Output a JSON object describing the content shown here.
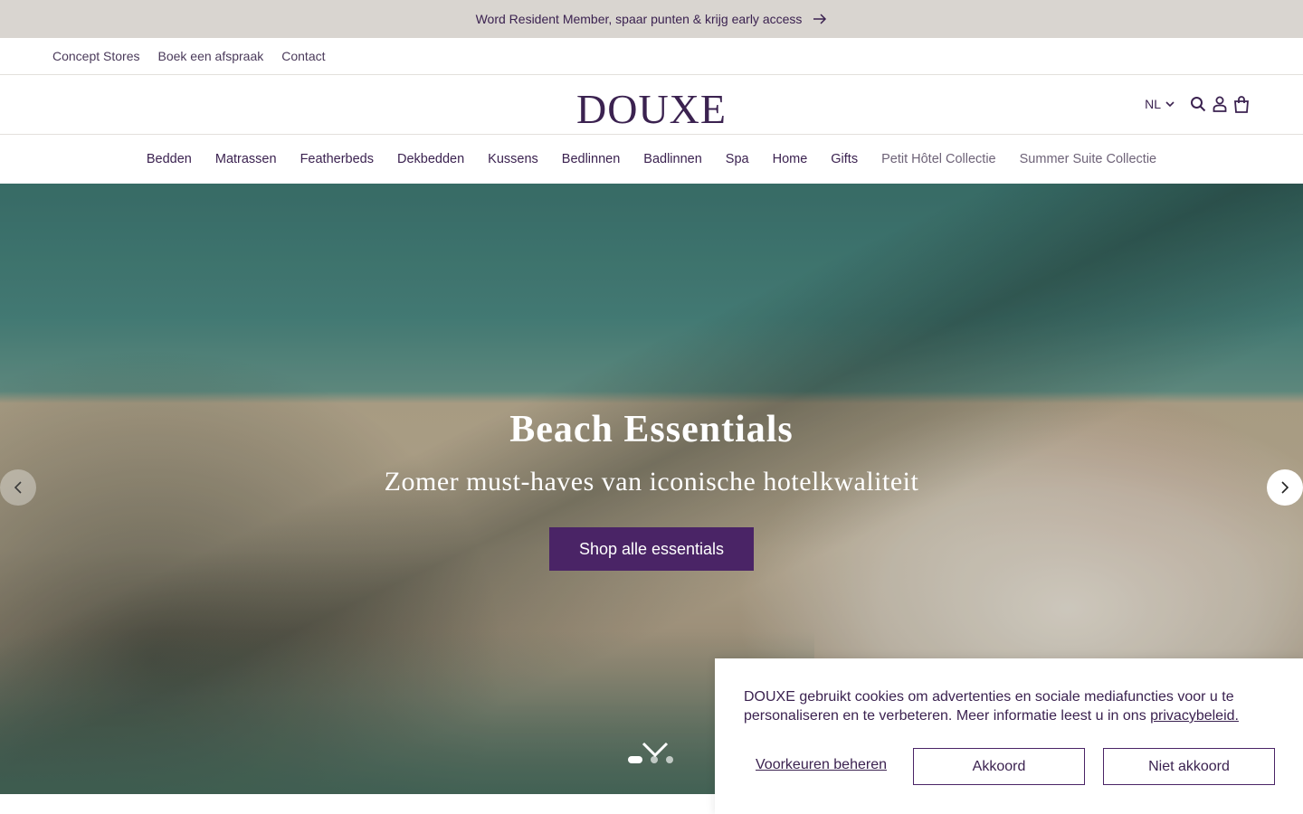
{
  "announcement": {
    "text": "Word Resident Member, spaar punten & krijg early access"
  },
  "utility_nav": [
    {
      "label": "Concept Stores"
    },
    {
      "label": "Boek een afspraak"
    },
    {
      "label": "Contact"
    }
  ],
  "header": {
    "logo": "DOUXE",
    "language": "NL",
    "icons": [
      "search-icon",
      "account-icon",
      "cart-icon"
    ]
  },
  "main_nav": [
    {
      "label": "Bedden"
    },
    {
      "label": "Matrassen"
    },
    {
      "label": "Featherbeds"
    },
    {
      "label": "Dekbedden"
    },
    {
      "label": "Kussens"
    },
    {
      "label": "Bedlinnen"
    },
    {
      "label": "Badlinnen"
    },
    {
      "label": "Spa"
    },
    {
      "label": "Home"
    },
    {
      "label": "Gifts"
    },
    {
      "label": "Petit Hôtel Collectie"
    },
    {
      "label": "Summer Suite Collectie"
    }
  ],
  "hero": {
    "title": "Beach Essentials",
    "subtitle": "Zomer must-haves van iconische hotelkwaliteit",
    "cta": "Shop alle essentials",
    "slide_count": 3,
    "active_slide": 1
  },
  "cookie_banner": {
    "text": "DOUXE gebruikt cookies om advertenties en sociale mediafuncties voor u te personaliseren en te verbeteren. Meer informatie leest u in ons",
    "link": "privacybeleid.",
    "preferences": "Voorkeuren beheren",
    "accept": "Akkoord",
    "decline": "Niet akkoord"
  },
  "colors": {
    "brand": "#3b2250",
    "cta_bg": "#4a2466",
    "announcement_bg": "#d9d5d0"
  }
}
